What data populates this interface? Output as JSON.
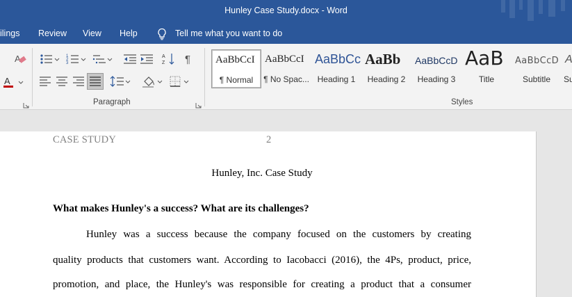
{
  "window": {
    "title": "Hunley Case Study.docx  -  Word"
  },
  "menu": {
    "tabs": [
      "ilings",
      "Review",
      "View",
      "Help"
    ],
    "tell_me": "Tell me what you want to do"
  },
  "ribbon": {
    "paragraph_label": "Paragraph",
    "styles_label": "Styles",
    "styles": [
      {
        "sample": "AaBbCcI",
        "name": "¶ Normal"
      },
      {
        "sample": "AaBbCcI",
        "name": "¶ No Spac..."
      },
      {
        "sample": "AaBbCc",
        "name": "Heading 1"
      },
      {
        "sample": "AaBb",
        "name": "Heading 2"
      },
      {
        "sample": "AaBbCcD",
        "name": "Heading 3"
      },
      {
        "sample": "AaB",
        "name": "Title"
      },
      {
        "sample": "AaBbCcD",
        "name": "Subtitle"
      },
      {
        "sample": "A",
        "name": "Su"
      }
    ],
    "colors": {
      "accent": "#2b579a",
      "font_color": "#c00000",
      "heading1": "#2f5496",
      "heading3": "#1f3864"
    }
  },
  "document": {
    "header_text": "CASE STUDY",
    "page_number": "2",
    "title": "Hunley, Inc. Case Study",
    "heading": "What makes Hunley's a success? What are its challenges?",
    "lines": [
      "Hunley was a success because the company focused on the customers by creating",
      "quality products that customers want. According to Iacobacci (2016), the 4Ps, product, price,",
      "promotion, and place, the Hunley's was responsible for creating a product that a consumer"
    ]
  }
}
